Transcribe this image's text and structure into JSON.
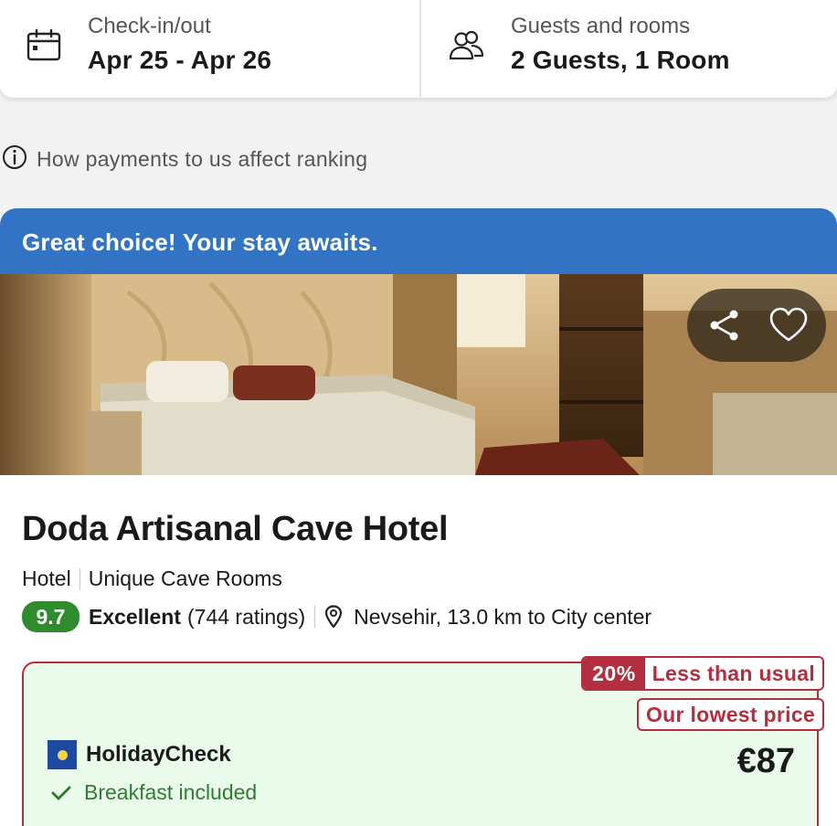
{
  "search": {
    "checkin_label": "Check-in/out",
    "checkin_value": "Apr 25 - Apr 26",
    "guests_label": "Guests and rooms",
    "guests_value": "2 Guests, 1 Room"
  },
  "ranking_info": "How payments to us affect ranking",
  "banner": "Great choice! Your stay awaits.",
  "hotel": {
    "name": "Doda Artisanal Cave Hotel",
    "type": "Hotel",
    "tag": "Unique Cave Rooms",
    "score": "9.7",
    "rating_word": "Excellent",
    "rating_count": "(744 ratings)",
    "location": "Nevsehir, 13.0 km to City center"
  },
  "deal": {
    "discount": "20%",
    "discount_label": "Less than usual",
    "lowest_label": "Our lowest price",
    "provider": "HolidayCheck",
    "price": "€87",
    "feature": "Breakfast included"
  },
  "colors": {
    "banner": "#3273c4",
    "score": "#2e8b2e",
    "deal_border": "#b32f3f",
    "deal_bg": "#ebfbeb",
    "feature_text": "#2e7d32"
  },
  "icons": {
    "checkin": "calendar-icon",
    "guests": "people-icon",
    "info": "info-icon",
    "share": "share-icon",
    "favorite": "heart-icon",
    "location": "location-pin-icon",
    "feature": "check-icon"
  }
}
